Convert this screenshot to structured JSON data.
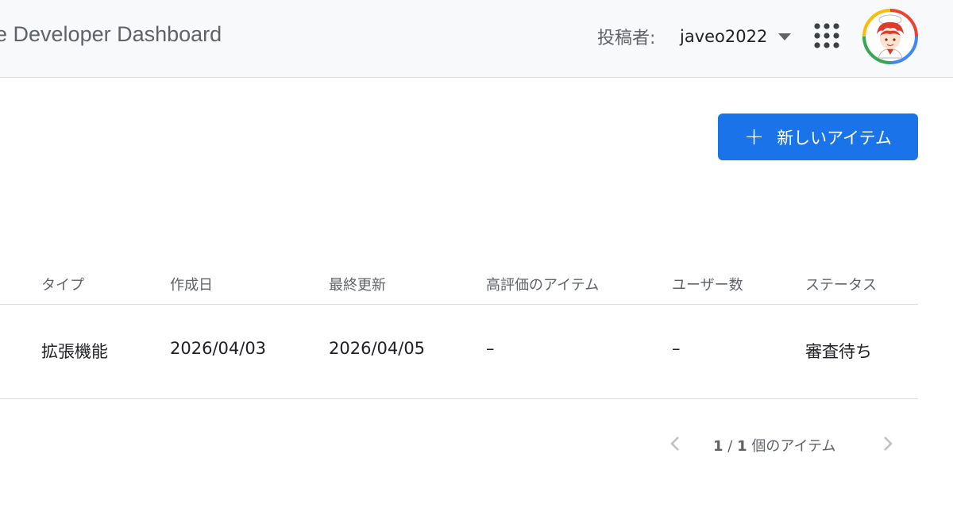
{
  "header": {
    "app_title": "e Developer Dashboard",
    "publisher_label": "投稿者:",
    "publisher_name": "javeo2022",
    "apps_icon": "apps-grid-icon",
    "avatar_icon": "user-avatar"
  },
  "toolbar": {
    "new_item_plus": "+",
    "new_item_label": "新しいアイテム"
  },
  "table": {
    "columns": [
      "タイプ",
      "作成日",
      "最終更新",
      "高評価のアイテム",
      "ユーザー数",
      "ステータス"
    ],
    "rows": [
      {
        "type": "拡張機能",
        "created": "2026/04/03",
        "updated": "2026/04/05",
        "featured": "–",
        "users": "–",
        "status": "審査待ち"
      }
    ]
  },
  "pagination": {
    "current": "1",
    "separator": "/",
    "total": "1",
    "suffix": "個のアイテム"
  },
  "colors": {
    "accent": "#1a73e8",
    "header_bg": "#f8f9fa",
    "divider": "#dadce0",
    "muted_text": "#5f6368"
  }
}
